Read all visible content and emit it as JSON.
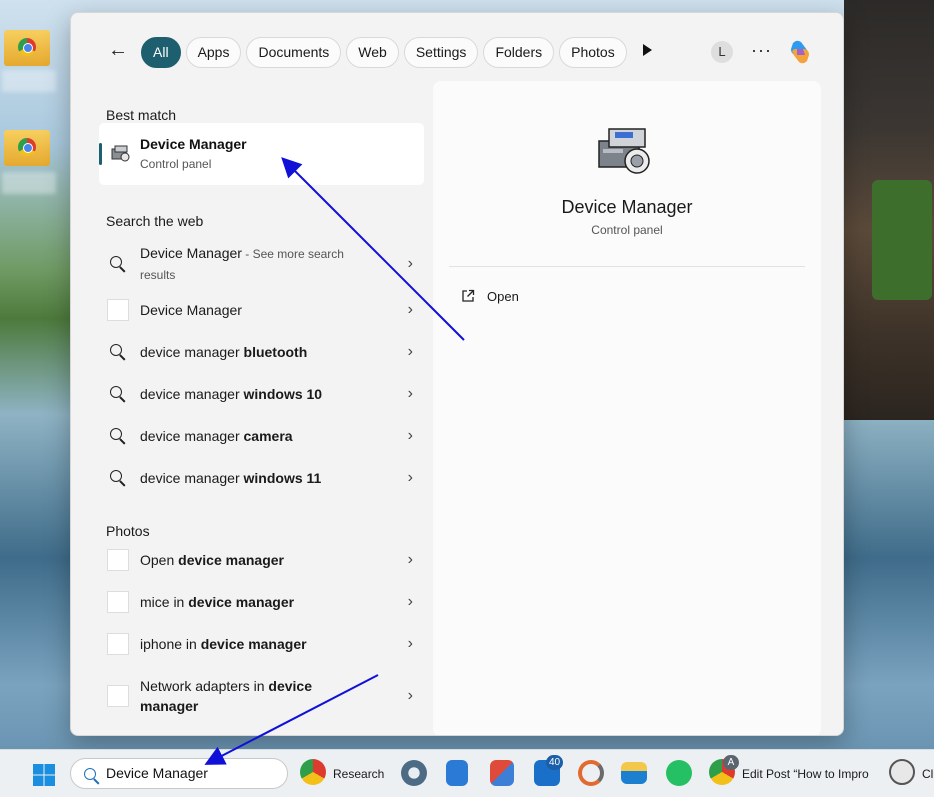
{
  "menu": {
    "back_icon": "back-arrow-icon",
    "filters": [
      "All",
      "Apps",
      "Documents",
      "Web",
      "Settings",
      "Folders",
      "Photos"
    ],
    "account_initial": "L",
    "more_label": "···"
  },
  "best_match": {
    "heading": "Best match",
    "title": "Device Manager",
    "subtitle": "Control panel"
  },
  "web": {
    "heading": "Search the web",
    "items": [
      {
        "plain": "Device Manager",
        "bold": "",
        "sub": " - See more search results",
        "icon": "search-icon"
      },
      {
        "plain": "Device Manager",
        "bold": "",
        "sub": "",
        "icon": "thumbnail-icon"
      },
      {
        "plain": "device manager ",
        "bold": "bluetooth",
        "sub": "",
        "icon": "search-icon"
      },
      {
        "plain": "device manager ",
        "bold": "windows 10",
        "sub": "",
        "icon": "search-icon"
      },
      {
        "plain": "device manager ",
        "bold": "camera",
        "sub": "",
        "icon": "search-icon"
      },
      {
        "plain": "device manager ",
        "bold": "windows 11",
        "sub": "",
        "icon": "search-icon"
      }
    ]
  },
  "photos": {
    "heading": "Photos",
    "items": [
      {
        "plain": "Open ",
        "bold": "device manager"
      },
      {
        "plain": "mice in ",
        "bold": "device manager"
      },
      {
        "plain": "iphone in ",
        "bold": "device manager"
      },
      {
        "plain": "Network adapters in ",
        "bold": "device manager"
      }
    ]
  },
  "detail": {
    "title": "Device Manager",
    "subtitle": "Control panel",
    "open_label": "Open"
  },
  "taskbar": {
    "search_value": "Device Manager",
    "research_label": "Research",
    "notification_count": "40",
    "chrome_badge": "A",
    "edit_post_label": "Edit Post “How to Impro",
    "last_label": "Cl"
  },
  "colors": {
    "accent": "#1d5f6e",
    "arrow": "#1010d8",
    "taskbar": "#edf0f3"
  }
}
